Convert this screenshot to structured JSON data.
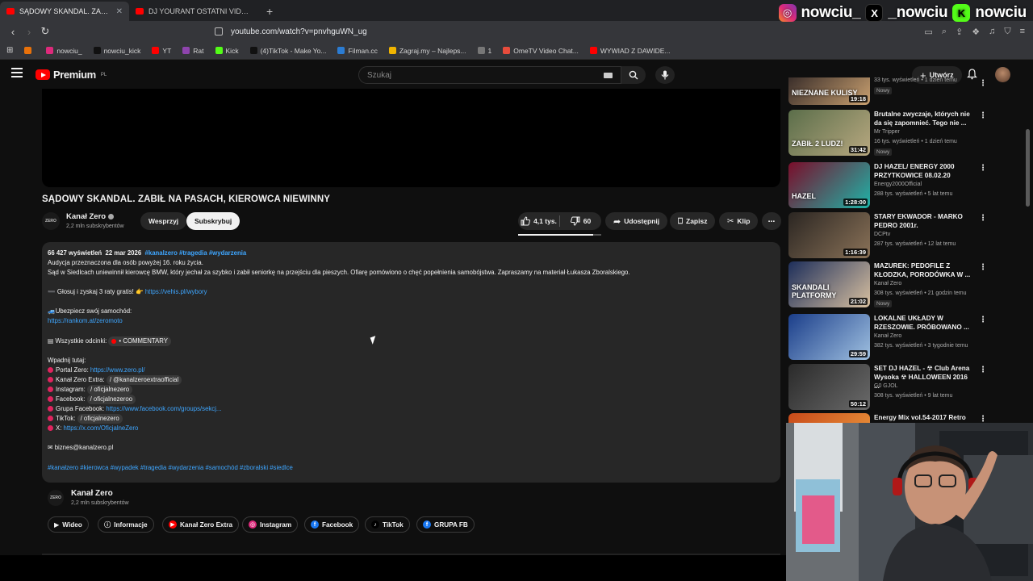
{
  "browser": {
    "tabs": [
      {
        "title": "SĄDOWY SKANDAL. ZABIŁ NA PASACH",
        "active": true
      },
      {
        "title": "DJ YOURANT OSTATNI VIDEOSET",
        "active": false
      }
    ],
    "new_tab": "+",
    "url": "youtube.com/watch?v=pnvhguWN_ug",
    "bookmarks": [
      {
        "label": "",
        "color": "#e8710a"
      },
      {
        "label": "nowciu_",
        "color": "#dd2a7b"
      },
      {
        "label": "nowciu_kick",
        "color": "#111111"
      },
      {
        "label": "YT",
        "color": "#ff0000"
      },
      {
        "label": "Rat",
        "color": "#8e44ad"
      },
      {
        "label": "Kick",
        "color": "#53fc18"
      },
      {
        "label": "(4)TikTok - Make Yo...",
        "color": "#111111"
      },
      {
        "label": "Filman.cc",
        "color": "#2b7cd3"
      },
      {
        "label": "Zagraj.my – Najleps...",
        "color": "#f0b400"
      },
      {
        "label": "1",
        "color": "#777777"
      },
      {
        "label": "OmeTV Video Chat...",
        "color": "#e74c3c"
      },
      {
        "label": "WYWIAD Z DAWIDE...",
        "color": "#ff0000"
      }
    ]
  },
  "overlay": {
    "instagram": "nowciu_",
    "x": "_nowciu",
    "kick": "nowciu",
    "kick_letter": "K",
    "x_letter": "X"
  },
  "header": {
    "logo": "Premium",
    "logo_region": "PL",
    "search_placeholder": "Szukaj",
    "create_label": "Utwórz"
  },
  "video": {
    "title": "SĄDOWY SKANDAL. ZABIŁ NA PASACH, KIEROWCA NIEWINNY",
    "channel": "Kanał Zero",
    "channel_avatar_text": "ZERO",
    "subscribers": "2,2 mln subskrybentów",
    "support_label": "Wesprzyj",
    "subscribe_label": "Subskrybuj",
    "likes": "4,1 tys.",
    "like_ratio": 0.9,
    "dislikes": "60",
    "share_label": "Udostępnij",
    "save_label": "Zapisz",
    "clip_label": "Klip",
    "more_label": "⋯"
  },
  "description": {
    "views": "66 427 wyświetleń",
    "date": "22 mar 2026",
    "tags_top": "#kanalzero #tragedia #wydarzenia",
    "age_note": "Audycja przeznaczona dla osób powyżej 16. roku życia.",
    "summary": "Sąd w Siedlcach uniewinnił kierowcę BMW, który jechał za szybko i zabił seniorkę na przejściu dla pieszych. Ofiarę pomówiono o chęć popełnienia samobójstwa. Zapraszamy na materiał Łukasza Zboralskiego.",
    "promo_text": "Głosuj i zyskaj 3 raty gratis! 👉",
    "promo_link": "https://vehis.pl/wybory",
    "insure_text": "Ubezpiecz swój samochód:",
    "insure_link": "https://rankom.at/zeromoto",
    "episodes_text": "Wszystkie odcinki:",
    "episodes_chip": "• COMMENTARY",
    "drop_in": "Wpadnij tutaj:",
    "links": [
      {
        "label": "Portal Zero:",
        "value": "https://www.zero.pl/",
        "is_link": true
      },
      {
        "label": "Kanał Zero Extra:",
        "value": "/ @kanalzeroextraofficial",
        "is_link": false
      },
      {
        "label": "Instagram:",
        "value": "/ oficjalnezero",
        "is_link": false
      },
      {
        "label": "Facebook:",
        "value": "/ oficjalnezeroo",
        "is_link": false
      },
      {
        "label": "Grupa Facebook:",
        "value": "https://www.facebook.com/groups/sekcj...",
        "is_link": true
      },
      {
        "label": "TikTok:",
        "value": "/ oficjalnezero",
        "is_link": false
      },
      {
        "label": "X:",
        "value": "https://x.com/OficjalneZero",
        "is_link": true
      }
    ],
    "email": "biznes@kanalzero.pl",
    "tags_bottom": "#kanałzero #kierowca #wypadek #tragedia #wydarzenia #samochód #zboralski #siedlce"
  },
  "channel_section": {
    "name": "Kanał Zero",
    "subscribers": "2,2 mln subskrybentów",
    "buttons": [
      "Wideo",
      "Informacje",
      "Kanał Zero Extra",
      "Instagram",
      "Facebook",
      "TikTok",
      "GRUPA FB"
    ]
  },
  "recommendations": [
    {
      "title": "",
      "channel": "",
      "meta": "33 tys. wyświetleń • 1 dzień temu",
      "duration": "19:18",
      "badge": "Nowy",
      "thumb_text": "NIEZNANE KULISY",
      "colors": [
        "#3a2e2a",
        "#c9a070"
      ]
    },
    {
      "title": "Brutalne zwyczaje, których nie da się zapomnieć. Tego nie ...",
      "channel": "Mr Tripper",
      "meta": "16 tys. wyświetleń • 1 dzień temu",
      "duration": "31:42",
      "badge": "Nowy",
      "thumb_text": "ZABIŁ 2 LUDZ!",
      "colors": [
        "#5b6e4a",
        "#b8a880"
      ]
    },
    {
      "title": "DJ HAZEL/ ENERGY 2000 PRZYTKOWICE 08.02.20",
      "channel": "Energy2000Official",
      "meta": "288 tys. wyświetleń • 5 lat temu",
      "duration": "1:28:00",
      "badge": "",
      "thumb_text": "HAZEL",
      "colors": [
        "#7a0d2a",
        "#1fb4a8"
      ]
    },
    {
      "title": "STARY EKWADOR - MARKO PEDRO 2001r.",
      "channel": "DCPtv",
      "meta": "287 tys. wyświetleń • 12 lat temu",
      "duration": "1:16:39",
      "badge": "",
      "thumb_text": "",
      "colors": [
        "#2b2622",
        "#8a7258"
      ]
    },
    {
      "title": "MAZUREK: PEDOFILE Z KŁODZKA, PORODÓWKA W ...",
      "channel": "Kanał Zero",
      "meta": "308 tys. wyświetleń • 21 godzin temu",
      "duration": "21:02",
      "badge": "Nowy",
      "thumb_text": "SKANDALI PLATFORMY",
      "colors": [
        "#1d2e5a",
        "#d8c0a0"
      ]
    },
    {
      "title": "LOKALNE UKŁADY W RZESZOWIE. PRÓBOWANO ...",
      "channel": "Kanał Zero",
      "meta": "382 tys. wyświetleń • 3 tygodnie temu",
      "duration": "29:59",
      "badge": "",
      "thumb_text": "",
      "colors": [
        "#1b3e8a",
        "#9fc0e0"
      ]
    },
    {
      "title": "SET DJ HAZEL - ☢ Club Arena Wysoka ☢ HALLOWEEN 2016 ...",
      "channel": "G0 GJOL",
      "meta": "308 tys. wyświetleń • 9 lat temu",
      "duration": "50:12",
      "badge": "",
      "thumb_text": "",
      "colors": [
        "#2a2a2a",
        "#6a6a6a"
      ]
    },
    {
      "title": "Energy Mix vol.54-2017 Retro",
      "channel": "",
      "meta": "",
      "duration": "",
      "badge": "",
      "thumb_text": "",
      "colors": [
        "#c84a1a",
        "#f0a040"
      ]
    }
  ]
}
